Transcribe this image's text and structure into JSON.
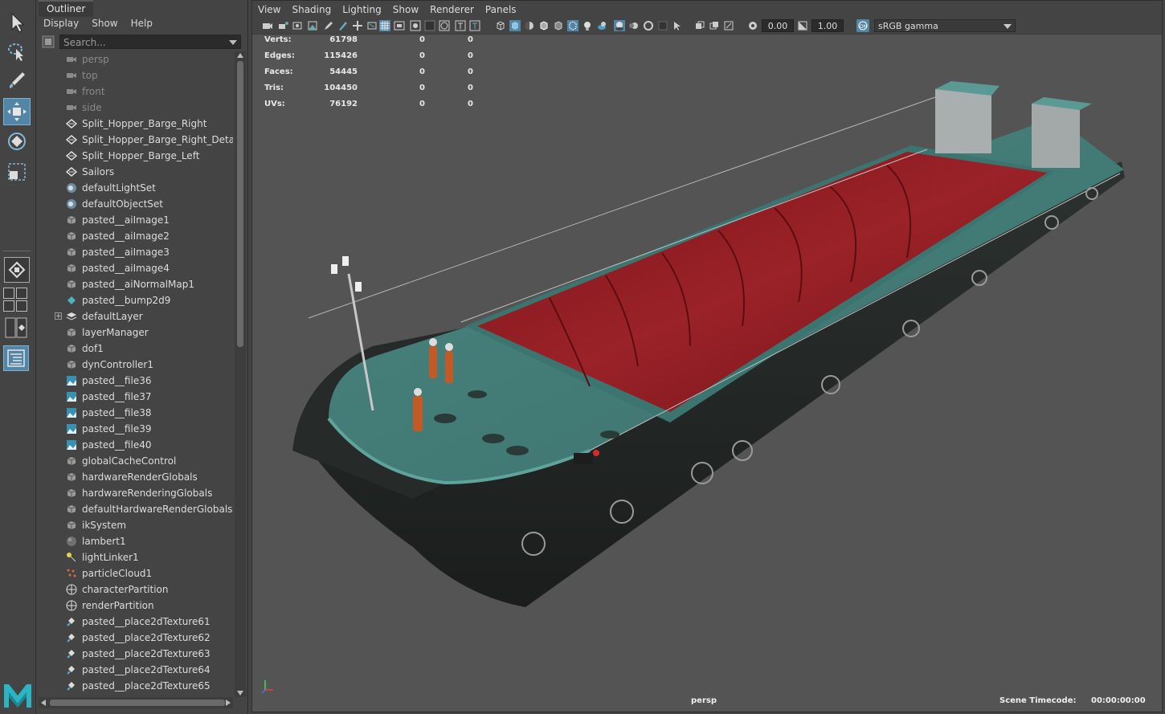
{
  "toolbox": {
    "tools": [
      "select-tool",
      "lasso-tool",
      "paint-select-tool",
      "move-tool",
      "rotate-tool",
      "scale-tool"
    ],
    "active_tool": "move-tool"
  },
  "outliner": {
    "tab_title": "Outliner",
    "menu": [
      "Display",
      "Show",
      "Help"
    ],
    "search_placeholder": "Search...",
    "items": [
      {
        "label": "persp",
        "icon": "camera-icon",
        "dim": true
      },
      {
        "label": "top",
        "icon": "camera-icon",
        "dim": true
      },
      {
        "label": "front",
        "icon": "camera-icon",
        "dim": true
      },
      {
        "label": "side",
        "icon": "camera-icon",
        "dim": true
      },
      {
        "label": "Split_Hopper_Barge_Right",
        "icon": "mesh-icon"
      },
      {
        "label": "Split_Hopper_Barge_Right_Detail",
        "icon": "mesh-icon"
      },
      {
        "label": "Split_Hopper_Barge_Left",
        "icon": "mesh-icon"
      },
      {
        "label": "Sailors",
        "icon": "mesh-icon"
      },
      {
        "label": "defaultLightSet",
        "icon": "set-icon"
      },
      {
        "label": "defaultObjectSet",
        "icon": "set-icon"
      },
      {
        "label": "pasted__aiImage1",
        "icon": "node-icon"
      },
      {
        "label": "pasted__aiImage2",
        "icon": "node-icon"
      },
      {
        "label": "pasted__aiImage3",
        "icon": "node-icon"
      },
      {
        "label": "pasted__aiImage4",
        "icon": "node-icon"
      },
      {
        "label": "pasted__aiNormalMap1",
        "icon": "node-icon"
      },
      {
        "label": "pasted__bump2d9",
        "icon": "bump-icon"
      },
      {
        "label": "defaultLayer",
        "icon": "layer-icon",
        "expandable": true
      },
      {
        "label": "layerManager",
        "icon": "node-icon"
      },
      {
        "label": "dof1",
        "icon": "node-icon"
      },
      {
        "label": "dynController1",
        "icon": "node-icon"
      },
      {
        "label": "pasted__file36",
        "icon": "file-texture-icon"
      },
      {
        "label": "pasted__file37",
        "icon": "file-texture-icon"
      },
      {
        "label": "pasted__file38",
        "icon": "file-texture-icon"
      },
      {
        "label": "pasted__file39",
        "icon": "file-texture-icon"
      },
      {
        "label": "pasted__file40",
        "icon": "file-texture-icon"
      },
      {
        "label": "globalCacheControl",
        "icon": "node-icon"
      },
      {
        "label": "hardwareRenderGlobals",
        "icon": "node-icon"
      },
      {
        "label": "hardwareRenderingGlobals",
        "icon": "node-icon"
      },
      {
        "label": "defaultHardwareRenderGlobals",
        "icon": "node-icon"
      },
      {
        "label": "ikSystem",
        "icon": "node-icon"
      },
      {
        "label": "lambert1",
        "icon": "material-sphere-icon"
      },
      {
        "label": "lightLinker1",
        "icon": "light-linker-icon"
      },
      {
        "label": "particleCloud1",
        "icon": "particle-icon"
      },
      {
        "label": "characterPartition",
        "icon": "partition-icon"
      },
      {
        "label": "renderPartition",
        "icon": "partition-icon"
      },
      {
        "label": "pasted__place2dTexture61",
        "icon": "place2d-icon"
      },
      {
        "label": "pasted__place2dTexture62",
        "icon": "place2d-icon"
      },
      {
        "label": "pasted__place2dTexture63",
        "icon": "place2d-icon"
      },
      {
        "label": "pasted__place2dTexture64",
        "icon": "place2d-icon"
      },
      {
        "label": "pasted__place2dTexture65",
        "icon": "place2d-icon"
      }
    ]
  },
  "viewport": {
    "menu": [
      "View",
      "Shading",
      "Lighting",
      "Show",
      "Renderer",
      "Panels"
    ],
    "exposure": "0.00",
    "gamma": "1.00",
    "color_space": "sRGB gamma",
    "hud": [
      {
        "key": "Verts:",
        "v1": "61798",
        "v2": "0",
        "v3": "0"
      },
      {
        "key": "Edges:",
        "v1": "115426",
        "v2": "0",
        "v3": "0"
      },
      {
        "key": "Faces:",
        "v1": "54445",
        "v2": "0",
        "v3": "0"
      },
      {
        "key": "Tris:",
        "v1": "104450",
        "v2": "0",
        "v3": "0"
      },
      {
        "key": "UVs:",
        "v1": "76192",
        "v2": "0",
        "v3": "0"
      }
    ],
    "camera": "persp",
    "timecode_label": "Scene Timecode:",
    "timecode_value": "00:00:00:00",
    "colors": {
      "background": "#545454",
      "hull": "#242826",
      "deck": "#4f8c87",
      "hopper": "#8e1d22",
      "accent": "#5285a6"
    }
  }
}
